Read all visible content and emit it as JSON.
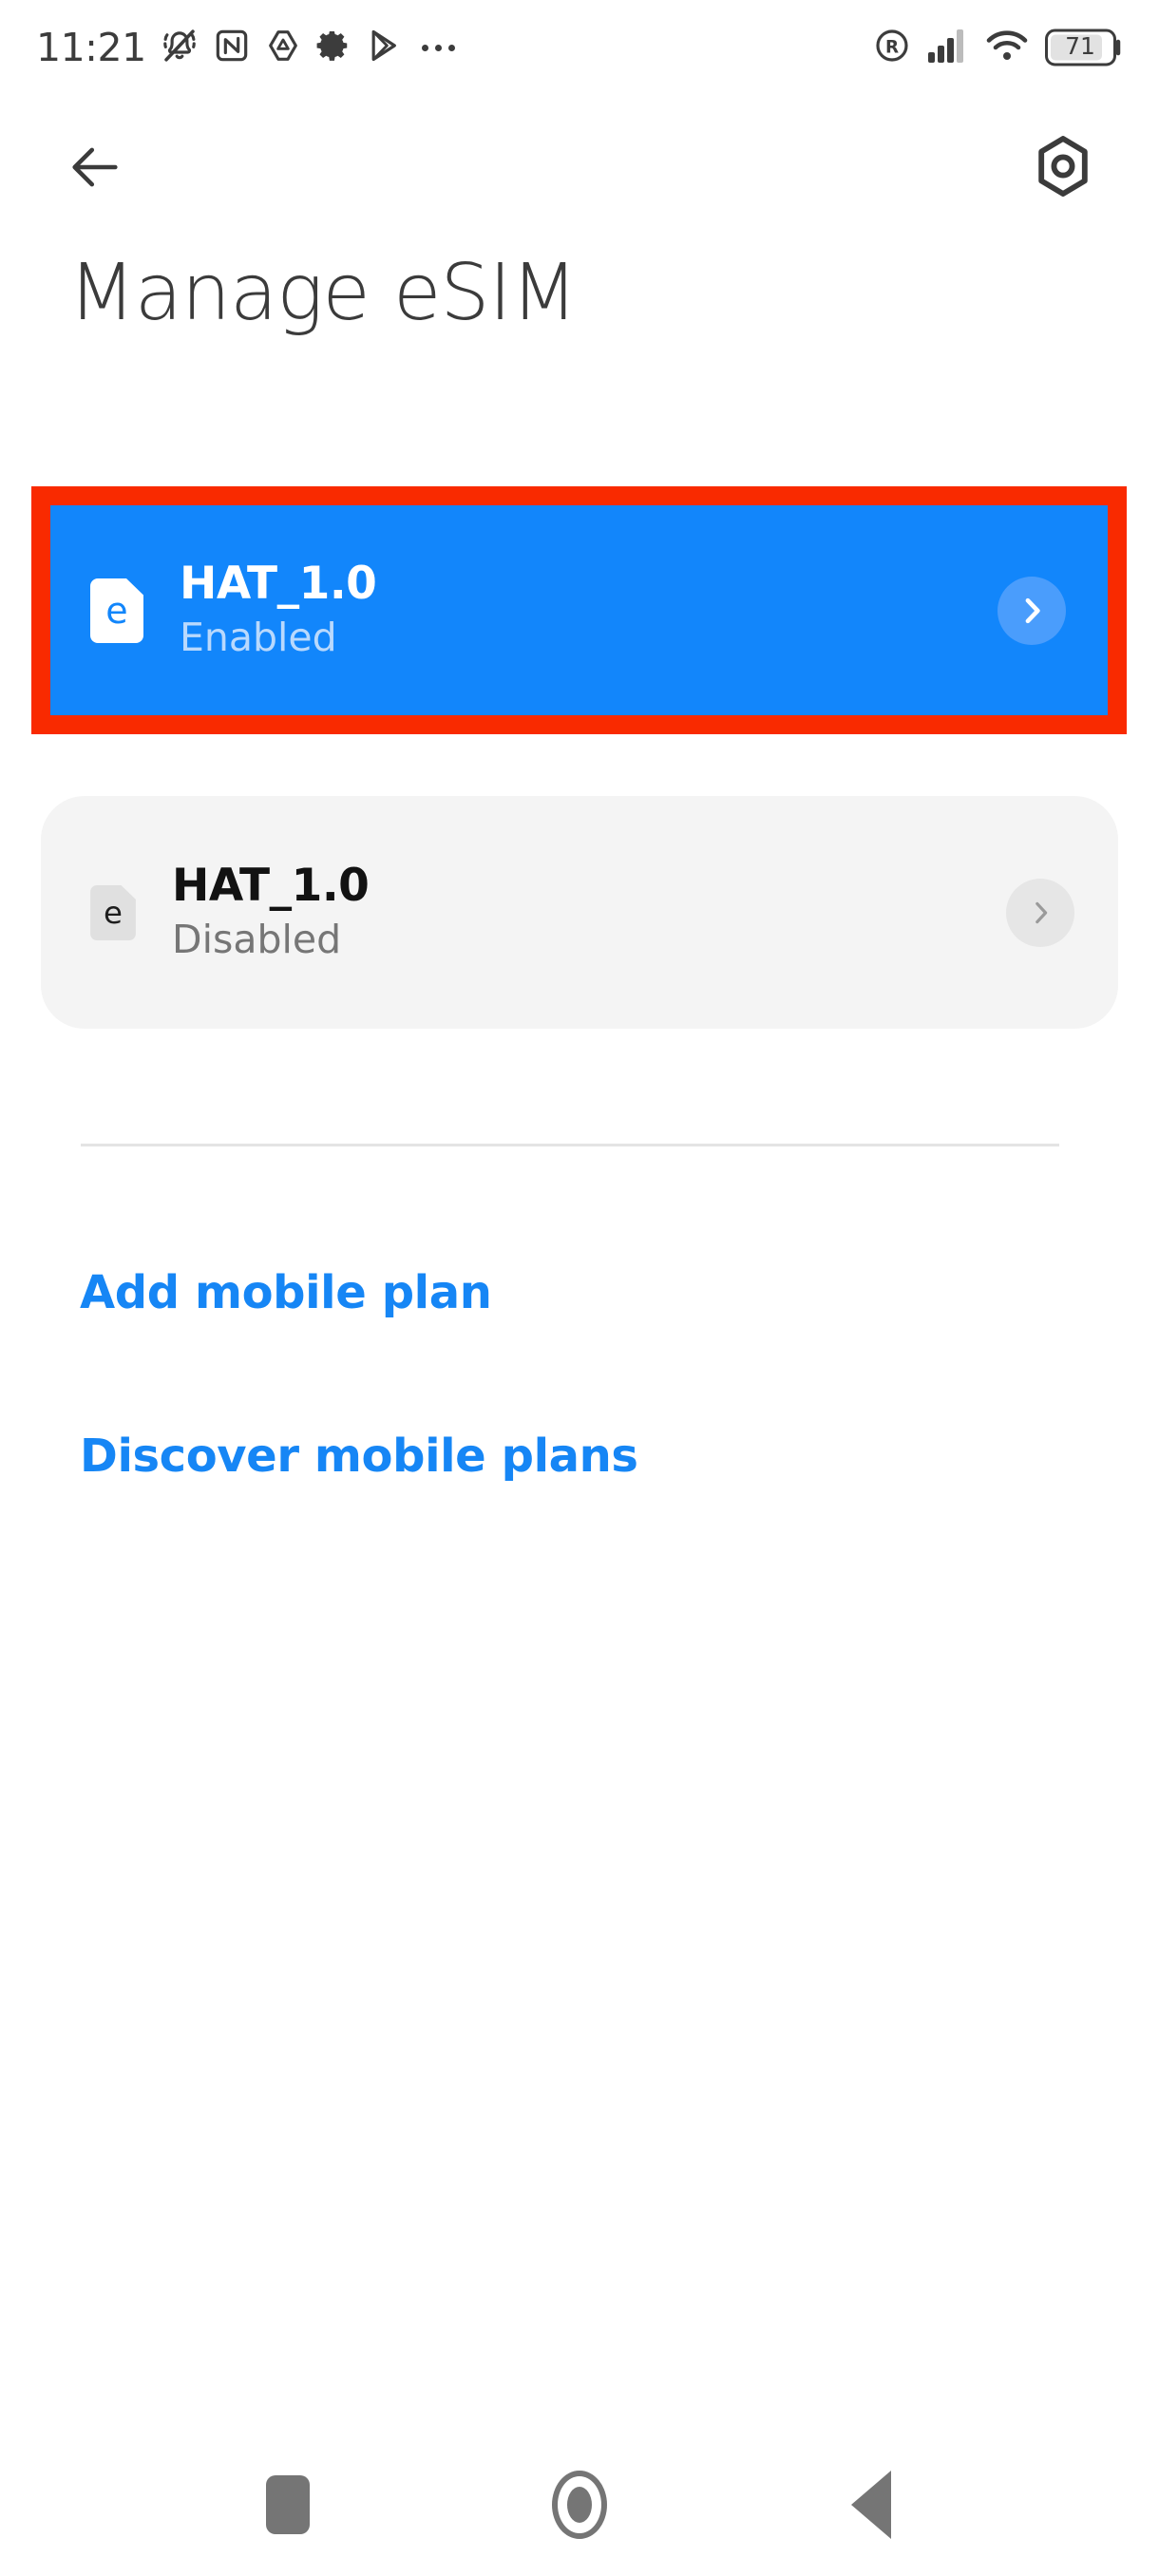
{
  "status_bar": {
    "time": "11:21",
    "battery_level": "71",
    "left_icons": [
      "silent-mode-icon",
      "nfc-icon",
      "drive-icon",
      "settings-gear-icon",
      "play-store-icon",
      "overflow-dots-icon"
    ],
    "right_icons": [
      "roaming-icon",
      "signal-bars-icon",
      "wifi-icon",
      "battery-icon"
    ]
  },
  "app_bar": {
    "back_icon": "back-arrow-icon",
    "settings_icon": "hex-settings-icon"
  },
  "page": {
    "title": "Manage eSIM"
  },
  "esim_profiles": [
    {
      "name": "HAT_1.0",
      "status": "Enabled",
      "selected": true,
      "icon": "esim-card-icon",
      "chevron": "chevron-right-icon"
    },
    {
      "name": "HAT_1.0",
      "status": "Disabled",
      "selected": false,
      "icon": "esim-card-icon",
      "chevron": "chevron-right-icon"
    }
  ],
  "links": {
    "add_mobile_plan": "Add mobile plan",
    "discover_mobile_plans": "Discover mobile plans"
  },
  "nav_bar": {
    "recents": "recents-square-icon",
    "home": "home-circle-icon",
    "back": "back-triangle-icon"
  },
  "colors": {
    "accent_blue": "#1286fb",
    "link_blue": "#1686f5",
    "highlight_red": "#f92a00",
    "card_gray": "#f4f4f4",
    "text_dark": "#3b3b3b"
  }
}
